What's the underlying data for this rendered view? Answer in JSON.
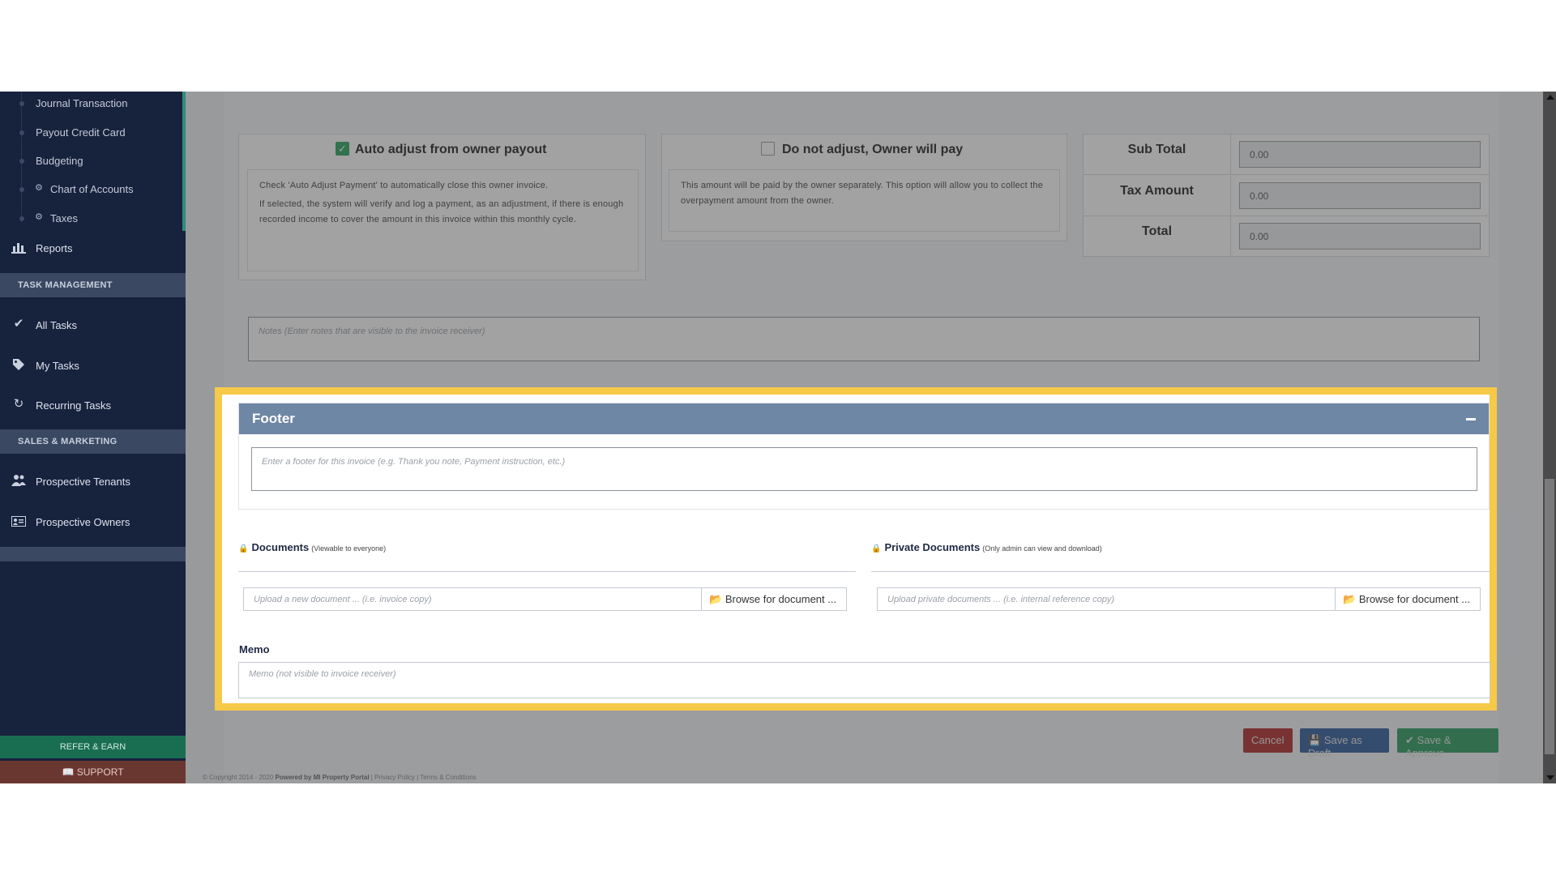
{
  "sidebar": {
    "sub_items": [
      "Journal Transaction",
      "Payout Credit Card",
      "Budgeting",
      "Chart of Accounts",
      "Taxes"
    ],
    "reports": "Reports",
    "task_section": "TASK MANAGEMENT",
    "tasks": [
      "All Tasks",
      "My Tasks",
      "Recurring Tasks"
    ],
    "sales_section": "SALES & MARKETING",
    "sales": [
      "Prospective Tenants",
      "Prospective Owners"
    ],
    "refer": "REFER & EARN",
    "support": "SUPPORT"
  },
  "adjust": {
    "auto_title": "Auto adjust from owner payout",
    "auto_checked": true,
    "auto_p1": "Check 'Auto Adjust Payment' to automatically close this owner invoice.",
    "auto_p2": "If selected, the system will verify and log a payment, as an adjustment, if there is enough recorded income to cover the amount in this invoice within this monthly cycle.",
    "owner_title": "Do not adjust, Owner will pay",
    "owner_checked": false,
    "owner_p1": "This amount will be paid by the owner separately. This option will allow you to collect the overpayment amount from the owner."
  },
  "totals": {
    "sub_total_label": "Sub Total",
    "sub_total": "0.00",
    "tax_label": "Tax Amount",
    "tax": "0.00",
    "total_label": "Total",
    "total": "0.00"
  },
  "notes_placeholder": "Notes (Enter notes that are visible to the invoice receiver)",
  "footer": {
    "title": "Footer",
    "placeholder": "Enter a footer for this invoice (e.g. Thank you note, Payment instruction, etc.)"
  },
  "documents": {
    "title": "Documents",
    "note": "(Viewable to everyone)",
    "placeholder": "Upload a new document ... (i.e. invoice copy)",
    "browse": "Browse for document ..."
  },
  "private_documents": {
    "title": "Private Documents",
    "note": "(Only admin can view and download)",
    "placeholder": "Upload private documents ... (i.e. internal reference copy)",
    "browse": "Browse for document ..."
  },
  "memo": {
    "label": "Memo",
    "placeholder": "Memo (not visible to invoice receiver)"
  },
  "buttons": {
    "cancel": "Cancel",
    "draft": "Save as Draft",
    "approve": "Save & Approve"
  },
  "copyright": {
    "prefix": "© Copyright 2014 - 2020",
    "powered": "Powered by MI Property Portal",
    "links": "| Privacy Policy | Terms & Conditions"
  },
  "colors": {
    "sidebar_bg": "#17223d",
    "highlight": "#f7c948",
    "footer_header": "#6e87a4",
    "cancel": "#b02a2a",
    "draft": "#2c5b9b",
    "approve": "#2a9a5f"
  }
}
